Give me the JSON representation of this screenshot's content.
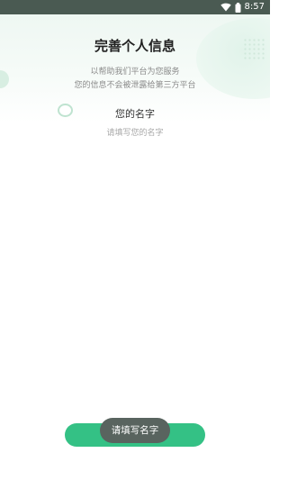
{
  "status_bar": {
    "time": "8:57"
  },
  "header": {
    "title": "完善个人信息",
    "subtitle_line1": "以帮助我们平台为您服务",
    "subtitle_line2": "您的信息不会被泄露给第三方平台"
  },
  "form": {
    "name_label": "您的名字",
    "name_value": "",
    "name_placeholder": "请填写您的名字"
  },
  "toast": {
    "message": "请填写名字"
  },
  "colors": {
    "accent": "#34c185",
    "toast_bg": "#59645f",
    "status_bar": "#4a5a52"
  }
}
